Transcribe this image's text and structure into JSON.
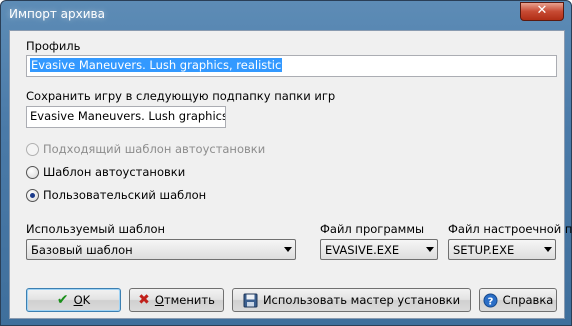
{
  "window": {
    "title": "Импорт архива",
    "close_label": "✕"
  },
  "profile": {
    "label": "Профиль",
    "value": "Evasive Maneuvers.  Lush graphics, realistic"
  },
  "subfolder": {
    "label": "Сохранить игру в следующую подпапку папки игр",
    "value": "Evasive Maneuvers.  Lush graphics, r"
  },
  "radios": [
    {
      "label": "Подходящий шаблон автоустановки",
      "checked": false,
      "disabled": true
    },
    {
      "label": "Шаблон автоустановки",
      "checked": false,
      "disabled": false
    },
    {
      "label": "Пользовательский шаблон",
      "checked": true,
      "disabled": false
    }
  ],
  "template": {
    "label": "Используемый шаблон",
    "value": "Базовый шаблон"
  },
  "program_file": {
    "label": "Файл программы",
    "value": "EVASIVE.EXE"
  },
  "setup_file": {
    "label": "Файл настроечной пр",
    "value": "SETUP.EXE"
  },
  "buttons": {
    "ok": {
      "prefix": "",
      "hotkey": "O",
      "rest": "K",
      "icon": "check-icon"
    },
    "cancel": {
      "prefix": "",
      "hotkey": "О",
      "rest": "тменить",
      "icon": "x-icon"
    },
    "wizard": {
      "label": "Использовать мастер установки",
      "icon": "floppy-disk-icon"
    },
    "help": {
      "label": "Справка",
      "icon": "question-icon"
    }
  },
  "colors": {
    "selection": "#3399ff",
    "default_button_border": "#3c7fb1"
  }
}
